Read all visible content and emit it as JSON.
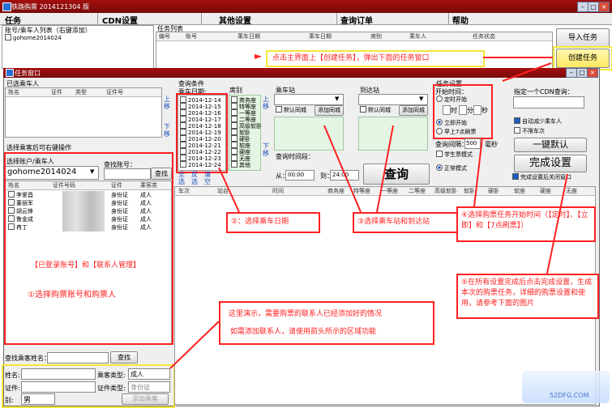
{
  "main": {
    "title": "铁路购票 2014121304 版",
    "menu": [
      "任务",
      "CDN设置",
      "其他设置",
      "查询订单",
      "帮助"
    ],
    "left_label": "账号/乘车人列表（右键添加）",
    "account": "gohome2014024",
    "task_list_label": "任务列表",
    "task_columns": [
      "编号",
      "账号",
      "乘车日期",
      "乘车日期",
      "席别",
      "乘车人",
      "任务状态"
    ],
    "btn_import": "导入任务",
    "btn_create": "创建任务"
  },
  "annotations": {
    "top": "点击主界面上【创建任务】，弹出下面的任务窗口",
    "a1_title": "【已登录账号】和【联系人管理】",
    "a1": "①选择购票账号和购票人",
    "a2": "②：选择乘车日期",
    "a3": "③选择乘车站和到达站",
    "a4": "④选择购票任务开始时间（【定时】、【立即】和【7点刷票】）",
    "a5": "⑤在所有设置完成后点击完成设置，生成本次的购票任务，详细的购票设置和使用，请参考下面的图片",
    "demo1": "这里演示，需要购票的联系人已经添加好的情况",
    "demo2": "如需添加联系人，请使用箭头所示的区域功能"
  },
  "task_window": {
    "title": "任务窗口",
    "selected_label": "已选乘车人",
    "sel_columns": [
      "姓名",
      "证件",
      "类型",
      "证件号"
    ],
    "up": "上移",
    "down": "下移",
    "rightclick": "选择乘客后可右键操作",
    "select_account_label": "选择账户/乘车人",
    "find_account_label": "查找账号：",
    "account_value": "gohome2014024",
    "find_btn": "查找",
    "pass_columns": [
      "姓名",
      "证件号码",
      "证件",
      "乘客类"
    ],
    "passengers": [
      {
        "name": "李爱昌",
        "id_type": "身份证",
        "type": "成人"
      },
      {
        "name": "董丽军",
        "id_type": "身份证",
        "type": "成人"
      },
      {
        "name": "胡云锋",
        "id_type": "身份证",
        "type": "成人"
      },
      {
        "name": "鲁金成",
        "id_type": "身份证",
        "type": "成人"
      },
      {
        "name": "冉丁",
        "id_type": "身份证",
        "type": "成人"
      }
    ],
    "query_cond": "查询条件",
    "date_label": "乘车日期:",
    "dates": [
      "2014-12-14",
      "2014-12-15",
      "2014-12-16",
      "2014-12-17",
      "2014-12-18",
      "2014-12-19",
      "2014-12-20",
      "2014-12-21",
      "2014-12-22",
      "2014-12-23",
      "2014-12-24"
    ],
    "date_ops": [
      "全选",
      "反选",
      "清空"
    ],
    "seat_label": "席别",
    "seats": [
      "商务座",
      "特等座",
      "一等座",
      "二等座",
      "高级软卧",
      "软卧",
      "硬卧",
      "软座",
      "硬座",
      "无座",
      "其他"
    ],
    "from_label": "乘车站",
    "to_label": "到达站",
    "default_same_city": "默认同城",
    "add_same_city": "添加同城",
    "time_range_label": "查询时间段：",
    "from_time_label": "从：",
    "from_time": "00:00",
    "to_time_label": "到：",
    "to_time": "24:00",
    "query_btn": "查询",
    "task_settings": "任务设置",
    "start_time": "开始时间：",
    "timed": "定时开始",
    "hour": "时",
    "minute": "分",
    "second": "秒",
    "immediate": "立即开始",
    "seven": "早上7点刷票",
    "interval_label": "查询间隔：",
    "interval": "500",
    "ms": "毫秒",
    "student": "学生票模式",
    "normal": "正常模式",
    "cdn_label": "指定一个CDN查询：",
    "auto_reduce": "自动减少乘车人",
    "no_ban": "不限车次",
    "one_key": "一键默认",
    "finish": "完成设置",
    "close_after": "完成设置后关闭窗口",
    "result_columns": [
      "车次",
      "站台",
      "时间",
      "商务座",
      "特等座",
      "一等座",
      "二等座",
      "高级软卧",
      "软卧",
      "硬卧",
      "软座",
      "硬座",
      "无座"
    ],
    "find_passenger": "查找乘客姓名：",
    "find_passenger_btn": "查找",
    "name_label": "姓名:",
    "pass_type_label": "乘客类型:",
    "pass_type": "成人",
    "id_label": "证件:",
    "id_type_label": "证件类型:",
    "id_type": "身份证",
    "gender_label": "别:",
    "gender": "男",
    "add_btn": "添加乘客"
  },
  "watermark": "52DFG.COM"
}
